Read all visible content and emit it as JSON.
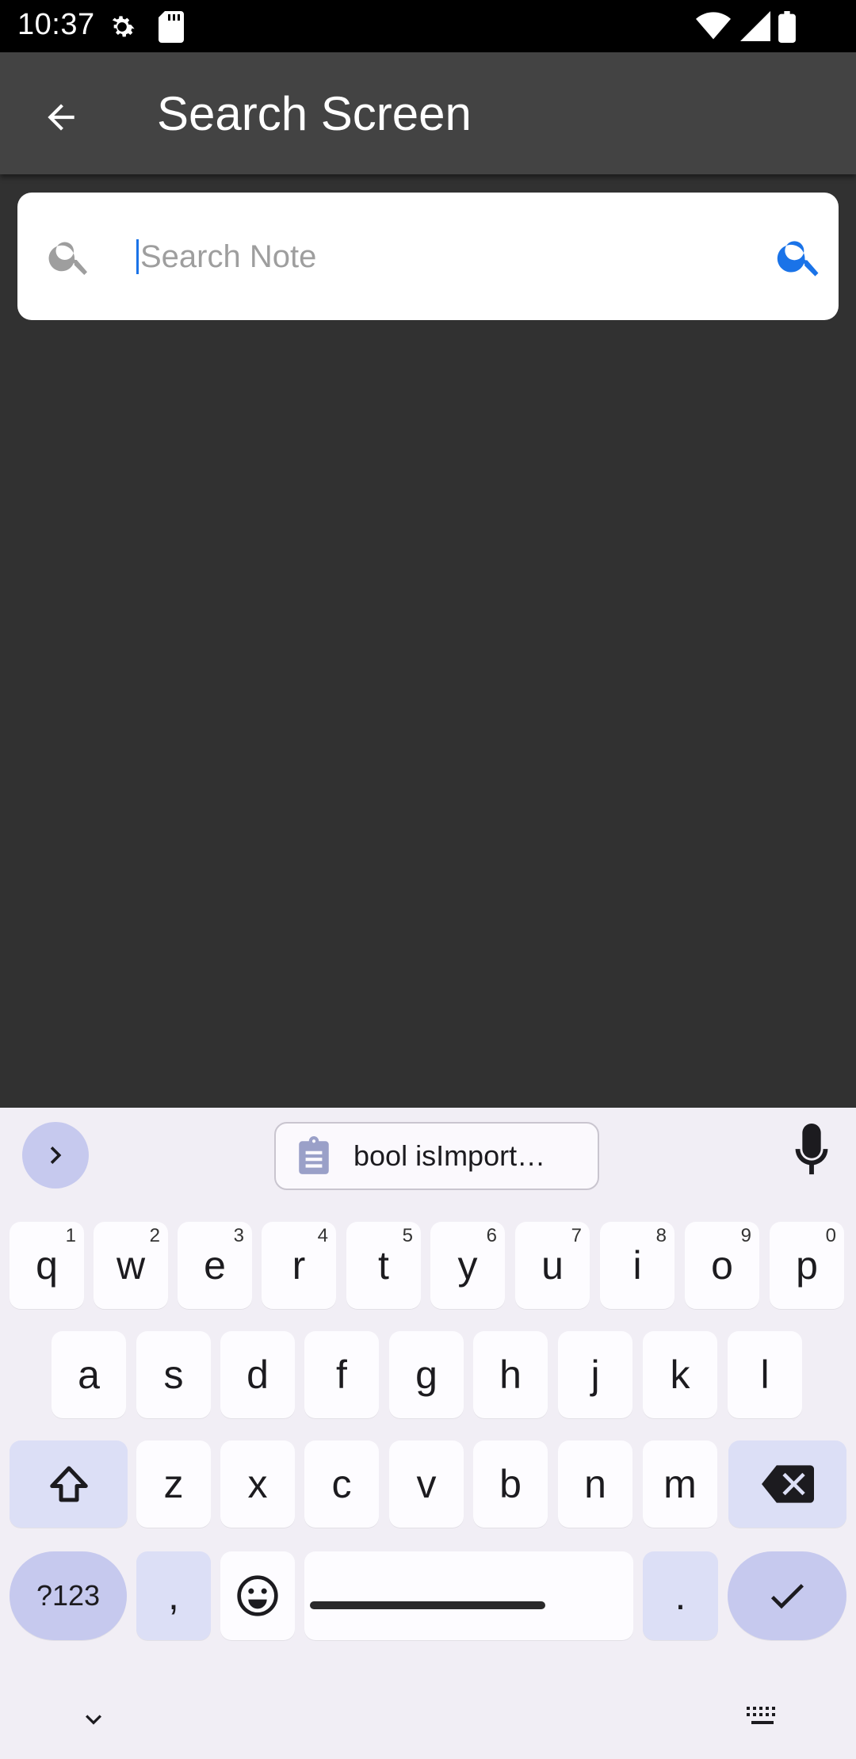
{
  "status_bar": {
    "time": "10:37",
    "icons": [
      "settings-gear-icon",
      "sd-card-icon",
      "wifi-icon",
      "signal-icon",
      "battery-icon"
    ]
  },
  "app_bar": {
    "title": "Search Screen",
    "back_icon": "arrow-left-icon"
  },
  "search": {
    "placeholder": "Search Note",
    "value": "",
    "leading_icon": "search-icon",
    "trailing_icon": "search-icon",
    "trailing_color": "#1a73e8"
  },
  "keyboard": {
    "suggestion_chip": "bool isImport…",
    "row1": [
      {
        "k": "q",
        "h": "1"
      },
      {
        "k": "w",
        "h": "2"
      },
      {
        "k": "e",
        "h": "3"
      },
      {
        "k": "r",
        "h": "4"
      },
      {
        "k": "t",
        "h": "5"
      },
      {
        "k": "y",
        "h": "6"
      },
      {
        "k": "u",
        "h": "7"
      },
      {
        "k": "i",
        "h": "8"
      },
      {
        "k": "o",
        "h": "9"
      },
      {
        "k": "p",
        "h": "0"
      }
    ],
    "row2": [
      "a",
      "s",
      "d",
      "f",
      "g",
      "h",
      "j",
      "k",
      "l"
    ],
    "row3": [
      "z",
      "x",
      "c",
      "v",
      "b",
      "n",
      "m"
    ],
    "symbols_label": "?123",
    "comma_label": ",",
    "period_label": "."
  }
}
